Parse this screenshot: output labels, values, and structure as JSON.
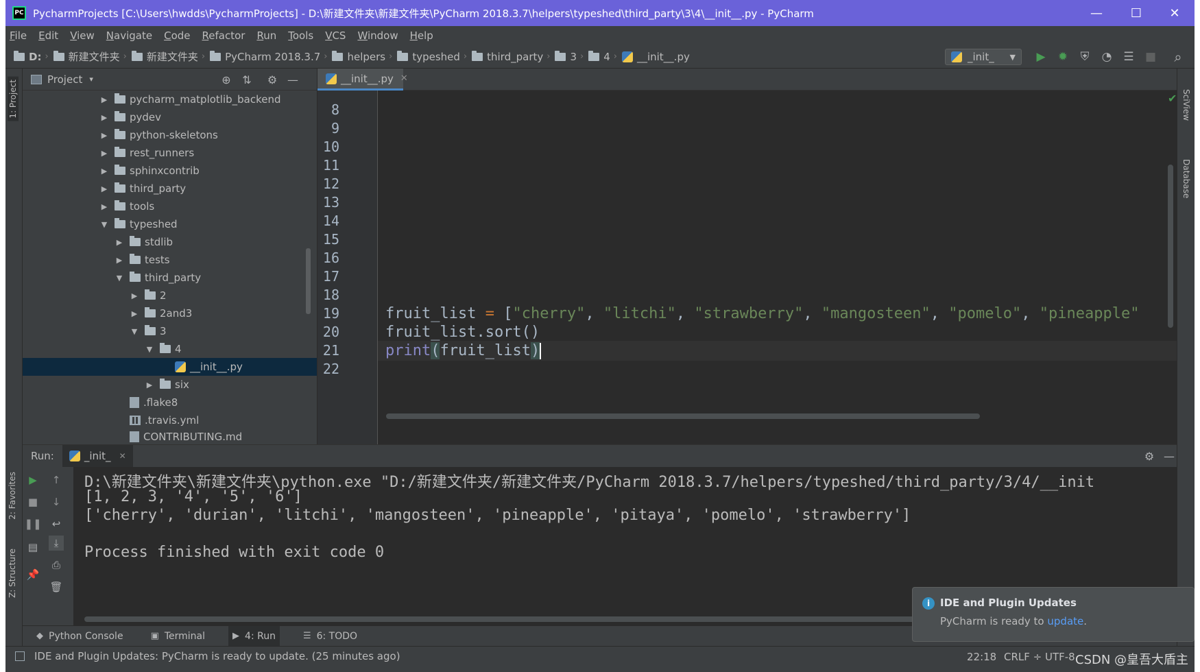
{
  "window": {
    "title": "PycharmProjects [C:\\Users\\hwdds\\PycharmProjects] - D:\\新建文件夹\\新建文件夹\\PyCharm 2018.3.7\\helpers\\typeshed\\third_party\\3\\4\\__init__.py - PyCharm",
    "app_icon": "PC",
    "minimize": "—",
    "maximize": "☐",
    "close": "✕"
  },
  "menu": [
    {
      "mnemonic": "F",
      "rest": "ile"
    },
    {
      "mnemonic": "E",
      "rest": "dit"
    },
    {
      "mnemonic": "V",
      "rest": "iew"
    },
    {
      "mnemonic": "N",
      "rest": "avigate"
    },
    {
      "mnemonic": "C",
      "rest": "ode"
    },
    {
      "mnemonic": "R",
      "rest": "efactor"
    },
    {
      "mnemonic": "R",
      "rest": "un"
    },
    {
      "mnemonic": "T",
      "rest": "ools"
    },
    {
      "mnemonic": "V",
      "rest": "CS"
    },
    {
      "mnemonic": "W",
      "rest": "indow"
    },
    {
      "mnemonic": "H",
      "rest": "elp"
    }
  ],
  "breadcrumbs": [
    "D:",
    "新建文件夹",
    "新建文件夹",
    "PyCharm 2018.3.7",
    "helpers",
    "typeshed",
    "third_party",
    "3",
    "4",
    "__init__.py"
  ],
  "toolbar": {
    "run_config": "_init_",
    "run_icon": "▶",
    "debug_icon": "✹",
    "coverage_icon": "⛨",
    "profile_icon": "◔",
    "concurrency_icon": "☰",
    "stop_icon": "■",
    "search_icon": "⌕"
  },
  "left_strip": {
    "project_tab": "1: Project",
    "favorites_tab": "2: Favorites",
    "structure_tab": "Z: Structure"
  },
  "right_strip": {
    "sciview_tab": "SciView",
    "database_tab": "Database"
  },
  "project_panel": {
    "title": "Project",
    "dropdown": "▾",
    "locate_icon": "⊕",
    "collapse_icon": "⇅",
    "settings_icon": "⚙",
    "hide_icon": "—",
    "tree": [
      {
        "label": "pycharm_matplotlib_backend",
        "toggle": "▶",
        "kind": "folder"
      },
      {
        "label": "pydev",
        "toggle": "▶",
        "kind": "folder"
      },
      {
        "label": "python-skeletons",
        "toggle": "▶",
        "kind": "folder"
      },
      {
        "label": "rest_runners",
        "toggle": "▶",
        "kind": "folder"
      },
      {
        "label": "sphinxcontrib",
        "toggle": "▶",
        "kind": "folder"
      },
      {
        "label": "third_party",
        "toggle": "▶",
        "kind": "folder"
      },
      {
        "label": "tools",
        "toggle": "▶",
        "kind": "folder"
      },
      {
        "label": "typeshed",
        "toggle": "▼",
        "kind": "folder"
      },
      {
        "label": "stdlib",
        "toggle": "▶",
        "kind": "folder"
      },
      {
        "label": "tests",
        "toggle": "▶",
        "kind": "folder"
      },
      {
        "label": "third_party",
        "toggle": "▼",
        "kind": "folder"
      },
      {
        "label": "2",
        "toggle": "▶",
        "kind": "folder"
      },
      {
        "label": "2and3",
        "toggle": "▶",
        "kind": "folder"
      },
      {
        "label": "3",
        "toggle": "▼",
        "kind": "folder"
      },
      {
        "label": "4",
        "toggle": "▼",
        "kind": "folder"
      },
      {
        "label": "__init__.py",
        "toggle": "",
        "kind": "python-file"
      },
      {
        "label": "six",
        "toggle": "▶",
        "kind": "folder"
      },
      {
        "label": ".flake8",
        "toggle": "",
        "kind": "file"
      },
      {
        "label": ".travis.yml",
        "toggle": "",
        "kind": "config"
      },
      {
        "label": "CONTRIBUTING.md",
        "toggle": "",
        "kind": "file"
      }
    ]
  },
  "editor": {
    "tab_label": "__init__.py",
    "tab_close": "✕",
    "line_numbers": [
      "8",
      "9",
      "10",
      "11",
      "12",
      "13",
      "14",
      "15",
      "16",
      "17",
      "18",
      "19",
      "20",
      "21",
      "22"
    ],
    "line20": {
      "var": "fruit_list",
      "op": " = ",
      "open": "[",
      "items": [
        "\"cherry\"",
        "\"litchi\"",
        "\"strawberry\"",
        "\"mangosteen\"",
        "\"pomelo\"",
        "\"pineapple\""
      ],
      "sep": ", "
    },
    "line21": "fruit_list.sort()",
    "line22": {
      "fn": "print",
      "open": "(",
      "arg": "fruit_list",
      "close": ")"
    },
    "status_check": "✔"
  },
  "run_panel": {
    "label": "Run:",
    "tab": "_init_",
    "tab_close": "✕",
    "settings_icon": "⚙",
    "hide_icon": "—",
    "console": [
      "D:\\新建文件夹\\新建文件夹\\python.exe \"D:/新建文件夹/新建文件夹/PyCharm 2018.3.7/helpers/typeshed/third_party/3/4/__init",
      "[1, 2, 3, '4', '5', '6']",
      "['cherry', 'durian', 'litchi', 'mangosteen', 'pineapple', 'pitaya', 'pomelo', 'strawberry']",
      "",
      "Process finished with exit code 0"
    ]
  },
  "bottom_tabs": [
    {
      "icon": "◆",
      "label": "Python Console"
    },
    {
      "icon": "▣",
      "label": "Terminal"
    },
    {
      "icon": "▶",
      "label": "4: Run"
    },
    {
      "icon": "☰",
      "label": "6: TODO"
    }
  ],
  "notification": {
    "title": "IDE and Plugin Updates",
    "body": "PyCharm is ready to ",
    "link": "update",
    "tail": "."
  },
  "status_bar": {
    "message": "IDE and Plugin Updates: PyCharm is ready to update. (25 minutes ago)",
    "position": "22:18",
    "line_sep": "CRLF ÷",
    "encoding": "UTF-8"
  },
  "watermark": "CSDN @皇吾大盾主",
  "colors": {
    "titlebar": "#6a62d9",
    "background": "#3c3f41",
    "editor": "#2b2b2b",
    "string": "#6a8759",
    "builtin": "#8888c6",
    "selection": "#0d293e",
    "link": "#589df6"
  }
}
